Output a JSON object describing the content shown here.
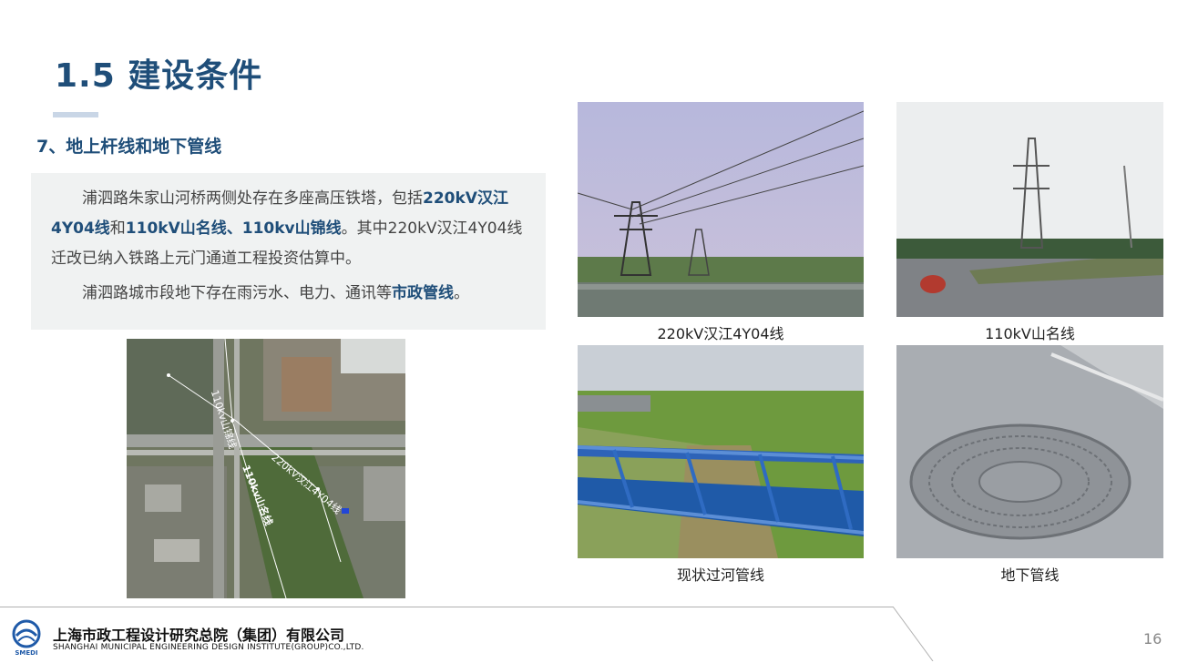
{
  "header": {
    "title": "1.5 建设条件",
    "subtitle": "7、地上杆线和地下管线"
  },
  "text": {
    "p1_a": "浦泗路朱家山河桥两侧处存在多座高压铁塔，包括",
    "p1_b": "220kV汉江4Y04线",
    "p1_c": "和",
    "p1_d": "110kV山名线、110kv山锦线",
    "p1_e": "。其中220kV汉江4Y04线迁改已纳入铁路上元门通道工程投资估算中。",
    "p2_a": "浦泗路城市段地下存在雨污水、电力、通讯等",
    "p2_b": "市政管线",
    "p2_c": "。"
  },
  "map": {
    "label_1": "110kv山锦线",
    "label_2": "220kV汉江4Y04线",
    "label_3": "110kv山名线"
  },
  "photos": {
    "caption_1": "220kV汉江4Y04线",
    "caption_2": "110kV山名线",
    "caption_3": "现状过河管线",
    "caption_4": "地下管线"
  },
  "footer": {
    "company_cn": "上海市政工程设计研究总院（集团）有限公司",
    "company_en": "SHANGHAI MUNICIPAL ENGINEERING DESIGN INSTITUTE(GROUP)CO.,LTD.",
    "logo_text": "SMEDI",
    "page_number": "16"
  },
  "colors": {
    "title": "#1f4e79",
    "highlight": "#1f4e79",
    "text_box_bg": "#f0f2f2"
  }
}
